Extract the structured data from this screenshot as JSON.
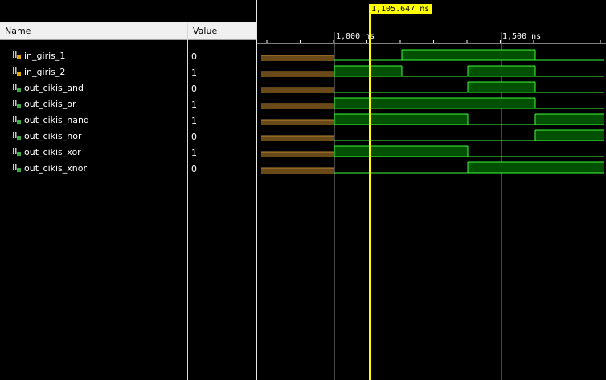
{
  "header": {
    "name_label": "Name",
    "value_label": "Value"
  },
  "signals": [
    {
      "name": "in_giris_1",
      "value": "0",
      "icon": "input-signal-icon"
    },
    {
      "name": "in_giris_2",
      "value": "1",
      "icon": "input-signal-icon"
    },
    {
      "name": "out_cikis_and",
      "value": "0",
      "icon": "output-signal-icon"
    },
    {
      "name": "out_cikis_or",
      "value": "1",
      "icon": "output-signal-icon"
    },
    {
      "name": "out_cikis_nand",
      "value": "1",
      "icon": "output-signal-icon"
    },
    {
      "name": "out_cikis_nor",
      "value": "0",
      "icon": "output-signal-icon"
    },
    {
      "name": "out_cikis_xor",
      "value": "1",
      "icon": "output-signal-icon"
    },
    {
      "name": "out_cikis_xnor",
      "value": "0",
      "icon": "output-signal-icon"
    }
  ],
  "timeline": {
    "cursor_label": "1,105.647 ns",
    "ticks": [
      {
        "label": "1,000 ns"
      },
      {
        "label": "1,500 ns"
      }
    ]
  },
  "colors": {
    "wave_high": "#005000",
    "wave_line": "#3aff3a",
    "undefined": "#6b4a1a",
    "cursor": "#ffff00"
  }
}
